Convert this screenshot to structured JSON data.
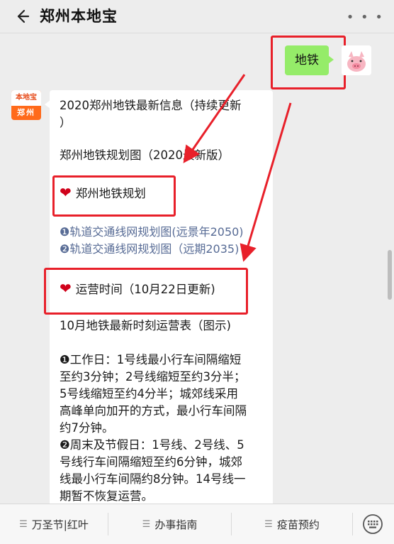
{
  "header": {
    "title": "郑州本地宝",
    "back_icon": "back-arrow-icon",
    "more_icon": "more-dots-icon"
  },
  "outgoing": {
    "text": "地铁"
  },
  "bot": {
    "avatar_top": "本地宝",
    "avatar_bottom": "郑州"
  },
  "message": {
    "line1": "2020郑州地铁最新信息（持续更新",
    "line2": "）",
    "line3": "郑州地铁规划图（2020最新版）",
    "heading1": "郑州地铁规划",
    "link1": "❶轨道交通线网规划图(远景年2050)",
    "link2": "❷轨道交通线网规划图（远期2035)",
    "heading2": "运营时间（10月22日更新)",
    "line4": "10月地铁最新时刻运营表（图示)",
    "p1": [
      "❶工作日：1号线最小行车间隔缩短",
      "至约3分钟；2号线缩短至约3分半；",
      "5号线缩短至约4分半；城郊线采用",
      "高峰单向加开的方式，最小行车间隔",
      "约7分钟。"
    ],
    "p2": [
      "❷周末及节假日：1号线、2号线、5",
      "号线行车间隔缩短至约6分钟，城郊",
      "线最小行车间隔约8分钟。14号线一",
      "期暂不恢复运营。"
    ]
  },
  "menu": [
    {
      "label": "万圣节|红叶"
    },
    {
      "label": "办事指南"
    },
    {
      "label": "疫苗预约"
    }
  ],
  "colors": {
    "accent_red": "#e8202a",
    "bubble_green": "#95ec69",
    "link_blue": "#576b95"
  }
}
